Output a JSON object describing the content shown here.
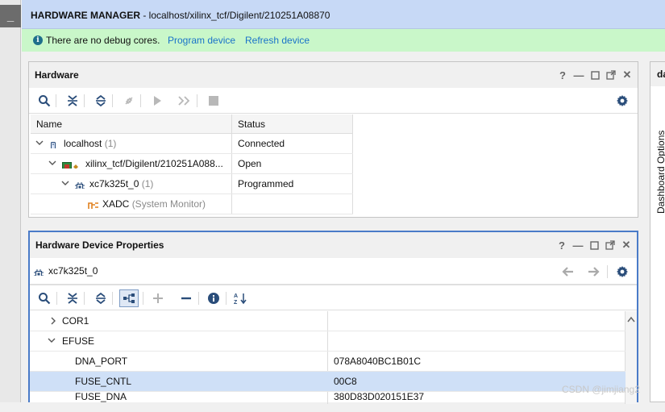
{
  "title_bar": {
    "prefix": "HARDWARE MANAGER",
    "path": " - localhost/xilinx_tcf/Digilent/210251A08870"
  },
  "left_strip": {
    "collapse_label": "_"
  },
  "info_bar": {
    "message": "There are no debug cores.",
    "program_link": "Program device",
    "refresh_link": "Refresh device"
  },
  "hardware_panel": {
    "title": "Hardware",
    "columns": [
      "Name",
      "Status"
    ],
    "rows": [
      {
        "name": "localhost",
        "count": "(1)",
        "status": "Connected",
        "icon": "server-icon"
      },
      {
        "name": "xilinx_tcf/Digilent/210251A088...",
        "count": "",
        "status": "Open",
        "icon": "board-icon"
      },
      {
        "name": "xc7k325t_0",
        "count": "(1)",
        "status": "Programmed",
        "icon": "chip-icon"
      },
      {
        "name": "XADC",
        "count": "(System Monitor)",
        "status": "",
        "icon": "xadc-icon"
      }
    ]
  },
  "properties_panel": {
    "title": "Hardware Device Properties",
    "device": "xc7k325t_0",
    "rows": [
      {
        "name": "COR1",
        "value": ""
      },
      {
        "name": "EFUSE",
        "value": ""
      },
      {
        "name": "DNA_PORT",
        "value": "078A8040BC1B01C"
      },
      {
        "name": "FUSE_CNTL",
        "value": "00C8"
      },
      {
        "name": "FUSE_DNA",
        "value": "380D83D020151E37"
      }
    ]
  },
  "side_panel": {
    "header": "da",
    "tab_label": "Dashboard Options"
  },
  "watermark": "CSDN @jimjiang2",
  "colors": {
    "title_bar": "#c7d9f6",
    "info_bar": "#c9f7c9",
    "selected_row": "#cfe0f7",
    "link": "#1a73c9",
    "active_border": "#4a7bc8"
  }
}
